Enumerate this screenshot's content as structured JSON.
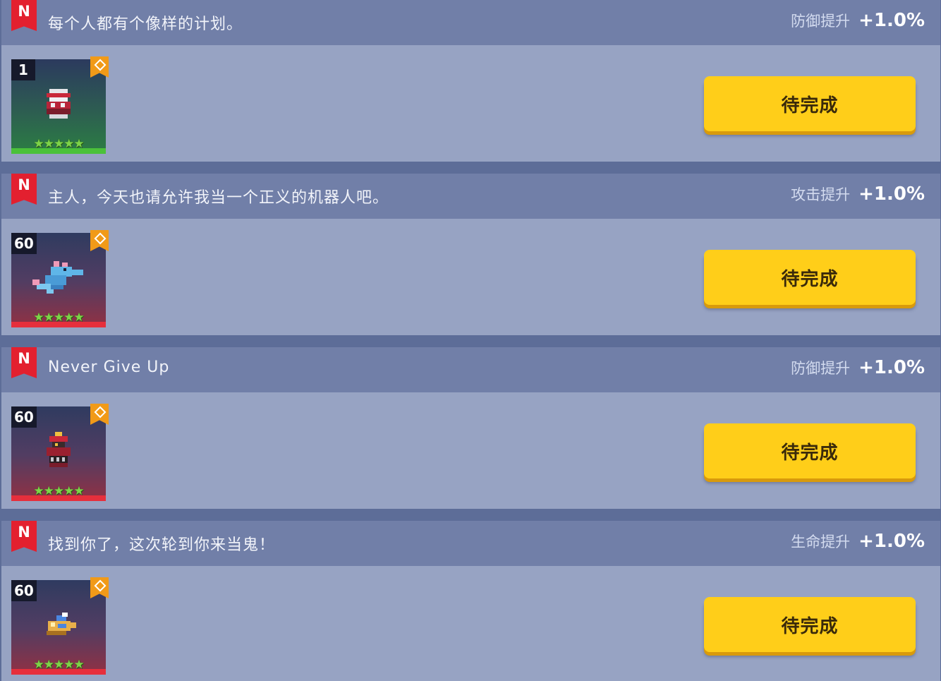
{
  "items": [
    {
      "badge": "N",
      "quote": "每个人都有个像样的计划。",
      "bonus_label": "防御提升",
      "bonus_value": "+1.0%",
      "level": "1",
      "stars": "★★★★★",
      "rarity_color": "green",
      "sprite": "red-white-cannon-sprite",
      "button_label": "待完成"
    },
    {
      "badge": "N",
      "quote": "主人，今天也请允许我当一个正义的机器人吧。",
      "bonus_label": "攻击提升",
      "bonus_value": "+1.0%",
      "level": "60",
      "stars": "★★★★★",
      "rarity_color": "red",
      "sprite": "blue-seahorse-dragon-sprite",
      "button_label": "待完成"
    },
    {
      "badge": "N",
      "quote": "Never Give Up",
      "bonus_label": "防御提升",
      "bonus_value": "+1.0%",
      "level": "60",
      "stars": "★★★★★",
      "rarity_color": "red",
      "sprite": "red-armored-robot-sprite",
      "button_label": "待完成"
    },
    {
      "badge": "N",
      "quote": "找到你了，这次轮到你来当鬼！",
      "bonus_label": "生命提升",
      "bonus_value": "+1.0%",
      "level": "60",
      "stars": "★★★★★",
      "rarity_color": "red",
      "sprite": "yellow-blue-creature-sprite",
      "button_label": "待完成"
    }
  ],
  "colors": {
    "background": "#5d6d98",
    "card": "#97a3c3",
    "card_header": "#717fa8",
    "badge_red": "#e3202f",
    "button_yellow": "#ffce19",
    "fav_orange": "#f19a18"
  }
}
